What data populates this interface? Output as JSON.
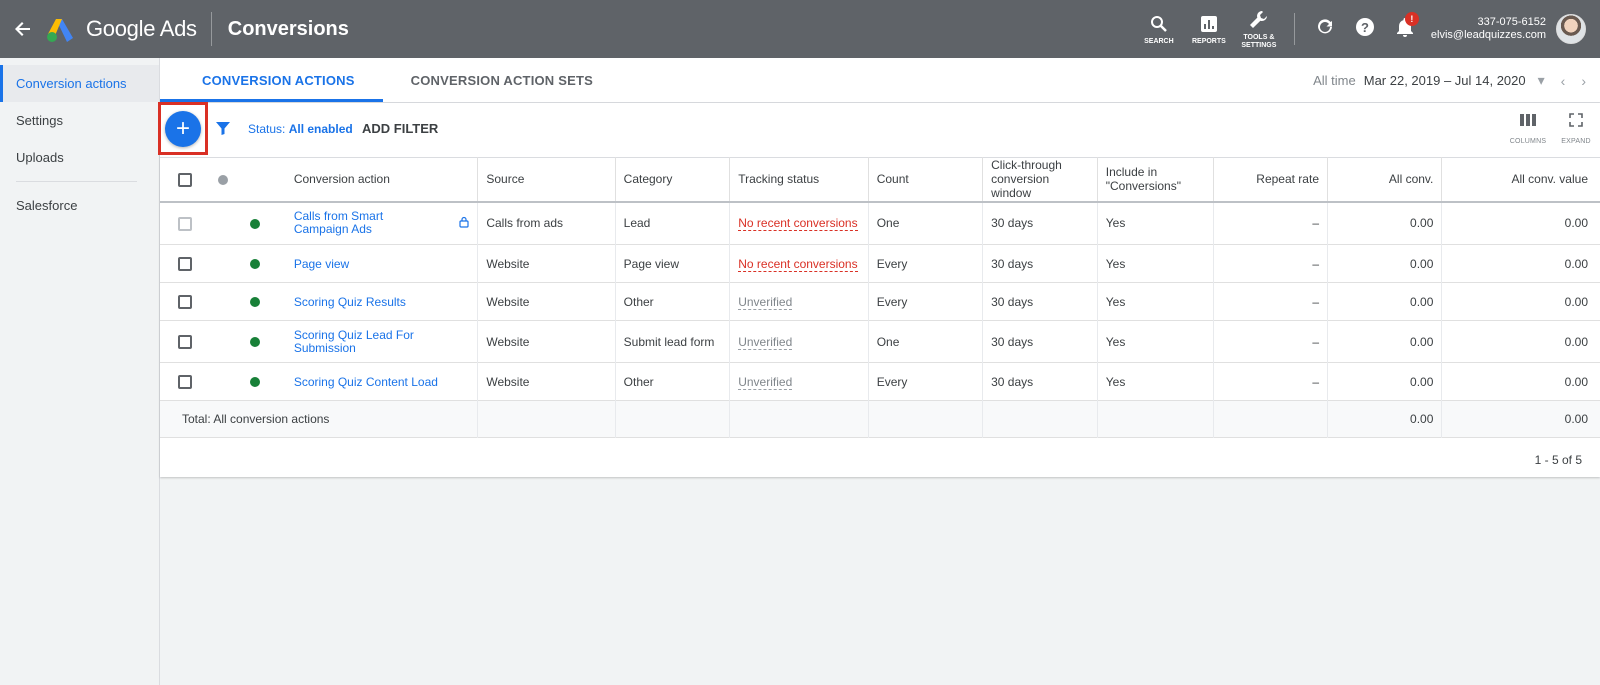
{
  "header": {
    "product": "Google Ads",
    "page_title": "Conversions",
    "tools": [
      {
        "label": "SEARCH",
        "icon": "search-icon"
      },
      {
        "label": "REPORTS",
        "icon": "reports-icon"
      },
      {
        "label": "TOOLS &\nSETTINGS",
        "icon": "wrench-icon"
      }
    ],
    "notification_count": "!",
    "account_id": "337-075-6152",
    "account_email": "elvis@leadquizzes.com"
  },
  "sidebar": {
    "items": [
      {
        "label": "Conversion actions",
        "active": true
      },
      {
        "label": "Settings",
        "active": false
      },
      {
        "label": "Uploads",
        "active": false
      },
      {
        "label": "Salesforce",
        "active": false
      }
    ]
  },
  "tabs": [
    {
      "label": "CONVERSION ACTIONS",
      "active": true
    },
    {
      "label": "CONVERSION ACTION SETS",
      "active": false
    }
  ],
  "date_range": {
    "label": "All time",
    "value": "Mar 22, 2019 – Jul 14, 2020"
  },
  "toolbar": {
    "add_label": "+",
    "status_key": "Status:",
    "status_value": "All enabled",
    "add_filter": "ADD FILTER",
    "columns_label": "COLUMNS",
    "expand_label": "EXPAND"
  },
  "table": {
    "headers": {
      "action": "Conversion action",
      "source": "Source",
      "category": "Category",
      "tracking": "Tracking status",
      "count": "Count",
      "window": "Click-through conversion window",
      "include": "Include in \"Conversions\"",
      "repeat": "Repeat rate",
      "all_conv": "All conv.",
      "all_conv_value": "All conv. value"
    },
    "rows": [
      {
        "action": "Calls from Smart Campaign Ads",
        "source": "Calls from ads",
        "category": "Lead",
        "tracking": "No recent conversions",
        "tracking_type": "red",
        "count": "One",
        "window": "30 days",
        "include": "Yes",
        "repeat": "–",
        "all_conv": "0.00",
        "all_conv_value": "0.00",
        "locked": true
      },
      {
        "action": "Page view",
        "source": "Website",
        "category": "Page view",
        "tracking": "No recent conversions",
        "tracking_type": "red",
        "count": "Every",
        "window": "30 days",
        "include": "Yes",
        "repeat": "–",
        "all_conv": "0.00",
        "all_conv_value": "0.00",
        "locked": false
      },
      {
        "action": "Scoring Quiz Results",
        "source": "Website",
        "category": "Other",
        "tracking": "Unverified",
        "tracking_type": "unver",
        "count": "Every",
        "window": "30 days",
        "include": "Yes",
        "repeat": "–",
        "all_conv": "0.00",
        "all_conv_value": "0.00",
        "locked": false
      },
      {
        "action": "Scoring Quiz Lead For Submission",
        "source": "Website",
        "category": "Submit lead form",
        "tracking": "Unverified",
        "tracking_type": "unver",
        "count": "One",
        "window": "30 days",
        "include": "Yes",
        "repeat": "–",
        "all_conv": "0.00",
        "all_conv_value": "0.00",
        "locked": false
      },
      {
        "action": "Scoring Quiz Content Load",
        "source": "Website",
        "category": "Other",
        "tracking": "Unverified",
        "tracking_type": "unver",
        "count": "Every",
        "window": "30 days",
        "include": "Yes",
        "repeat": "–",
        "all_conv": "0.00",
        "all_conv_value": "0.00",
        "locked": false
      }
    ],
    "total": {
      "label": "Total: All conversion actions",
      "all_conv": "0.00",
      "all_conv_value": "0.00"
    },
    "pagination": "1 - 5 of 5"
  },
  "colors": {
    "accent": "#1a73e8",
    "topbar": "#5f6368",
    "error": "#d93025",
    "enabled": "#188038"
  }
}
